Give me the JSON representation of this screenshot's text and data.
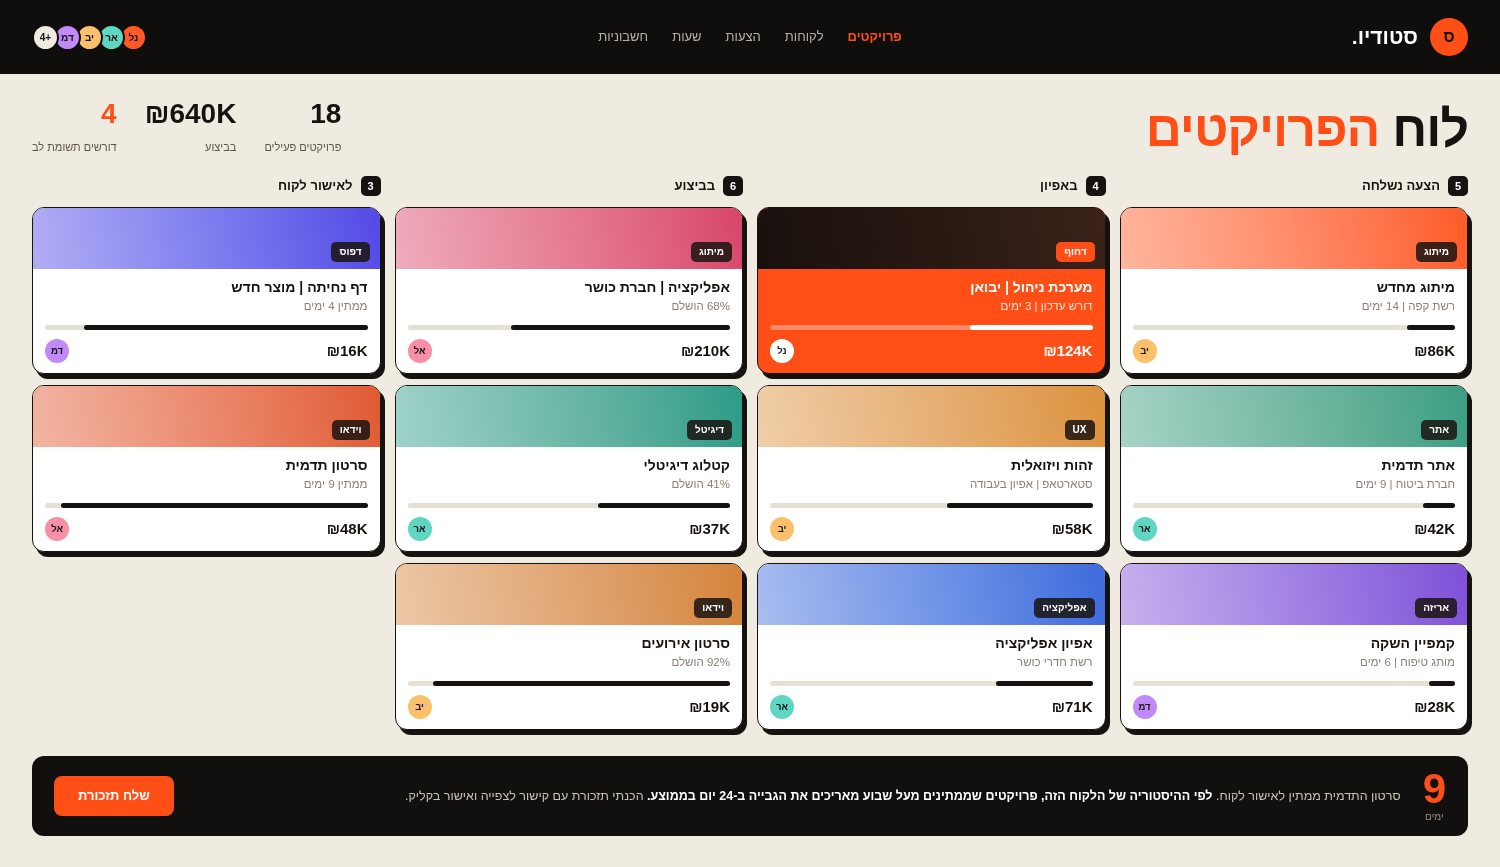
{
  "header": {
    "logo": {
      "mark": "ס",
      "name": "סטודיו."
    },
    "nav": [
      {
        "label": "פרויקטים",
        "selected": true
      },
      {
        "label": "לקוחות",
        "selected": false
      },
      {
        "label": "הצעות",
        "selected": false
      },
      {
        "label": "שעות",
        "selected": false
      },
      {
        "label": "חשבוניות",
        "selected": false
      }
    ],
    "team": [
      {
        "initials": "נל",
        "color": "#ff5a26"
      },
      {
        "initials": "אר",
        "color": "#5fd6c2"
      },
      {
        "initials": "יב",
        "color": "#fbc06b"
      },
      {
        "initials": "דמ",
        "color": "#c08af8"
      }
    ],
    "team_more": "4+"
  },
  "title": {
    "text": "לוח",
    "highlight": "הפרויקטים"
  },
  "stats": [
    {
      "value": "18",
      "label": "פרויקטים פעילים",
      "alert": false
    },
    {
      "value": "₪640K",
      "label": "בביצוע",
      "alert": false
    },
    {
      "value": "4",
      "label": "דורשים תשומת לב",
      "alert": true
    }
  ],
  "columns": [
    {
      "title": "הצעה נשלחה",
      "count": "5",
      "cards": [
        {
          "tag": "מיתוג",
          "title": "מיתוג מחדש",
          "meta": "רשת קפה | 14 ימים",
          "level": 0.15,
          "budget": "₪86K",
          "owner": {
            "initials": "יב",
            "color": "#fbc06b"
          },
          "urgent": false,
          "color": "#ff5a26"
        },
        {
          "tag": "אתר",
          "title": "אתר תדמית",
          "meta": "חברת ביטוח | 9 ימים",
          "level": 0.1,
          "budget": "₪42K",
          "owner": {
            "initials": "אר",
            "color": "#5fd6c2"
          },
          "urgent": false,
          "color": "#3a9e82"
        },
        {
          "tag": "אריזה",
          "title": "קמפיין השקה",
          "meta": "מותג טיפוח | 6 ימים",
          "level": 0.08,
          "budget": "₪28K",
          "owner": {
            "initials": "דמ",
            "color": "#c08af8"
          },
          "urgent": false,
          "color": "#8050d8"
        }
      ]
    },
    {
      "title": "באפיון",
      "count": "4",
      "cards": [
        {
          "tag": "דחוף",
          "title": "מערכת ניהול | יבואן",
          "meta": "דורש עדכון | 3 ימים",
          "level": 0.38,
          "budget": "₪124K",
          "owner": {
            "initials": "נל",
            "color": "#ffffff"
          },
          "urgent": true,
          "color": "#3a2218"
        },
        {
          "tag": "UX",
          "title": "זהות ויזואלית",
          "meta": "סטארטאפ | אפיון בעבודה",
          "level": 0.45,
          "budget": "₪58K",
          "owner": {
            "initials": "יב",
            "color": "#fbc06b"
          },
          "urgent": false,
          "color": "#dc923c"
        },
        {
          "tag": "אפליקציה",
          "title": "אפיון אפליקציה",
          "meta": "רשת חדרי כושר",
          "level": 0.3,
          "budget": "₪71K",
          "owner": {
            "initials": "אר",
            "color": "#5fd6c2"
          },
          "urgent": false,
          "color": "#3e6bdc"
        }
      ]
    },
    {
      "title": "בביצוע",
      "count": "6",
      "cards": [
        {
          "tag": "מיתוג",
          "title": "אפליקציה | חברת כושר",
          "meta": "68% הושלם",
          "level": 0.68,
          "budget": "₪210K",
          "owner": {
            "initials": "אל",
            "color": "#f78fa7"
          },
          "urgent": false,
          "color": "#d8456a"
        },
        {
          "tag": "דיגיטל",
          "title": "קטלוג דיגיטלי",
          "meta": "41% הושלם",
          "level": 0.41,
          "budget": "₪37K",
          "owner": {
            "initials": "אר",
            "color": "#5fd6c2"
          },
          "urgent": false,
          "color": "#2a9c86"
        },
        {
          "tag": "וידאו",
          "title": "סרטון אירועים",
          "meta": "92% הושלם",
          "level": 0.92,
          "budget": "₪19K",
          "owner": {
            "initials": "יב",
            "color": "#fbc06b"
          },
          "urgent": false,
          "color": "#d4843a"
        }
      ]
    },
    {
      "title": "לאישור לקוח",
      "count": "3",
      "cards": [
        {
          "tag": "דפוס",
          "title": "דף נחיתה | מוצר חדש",
          "meta": "ממתין 4 ימים",
          "level": 0.88,
          "budget": "₪16K",
          "owner": {
            "initials": "דמ",
            "color": "#c08af8"
          },
          "urgent": false,
          "color": "#5548e6"
        },
        {
          "tag": "וידאו",
          "title": "סרטון תדמית",
          "meta": "ממתין 9 ימים",
          "level": 0.95,
          "budget": "₪48K",
          "owner": {
            "initials": "אל",
            "color": "#f78fa7"
          },
          "urgent": false,
          "color": "#e05a32"
        }
      ]
    }
  ],
  "banner": {
    "days": "9",
    "days_label": "ימים",
    "text": "סרטון התדמית ממתין לאישור לקוח. **לפי ההיסטוריה של הלקוח הזה, פרויקטים שממתינים מעל שבוע מאריכים את הגבייה ב-24 יום בממוצע.** הכנתי תזכורת עם קישור לצפייה ואישור בקליק.",
    "action": "שלח תזכורת"
  }
}
